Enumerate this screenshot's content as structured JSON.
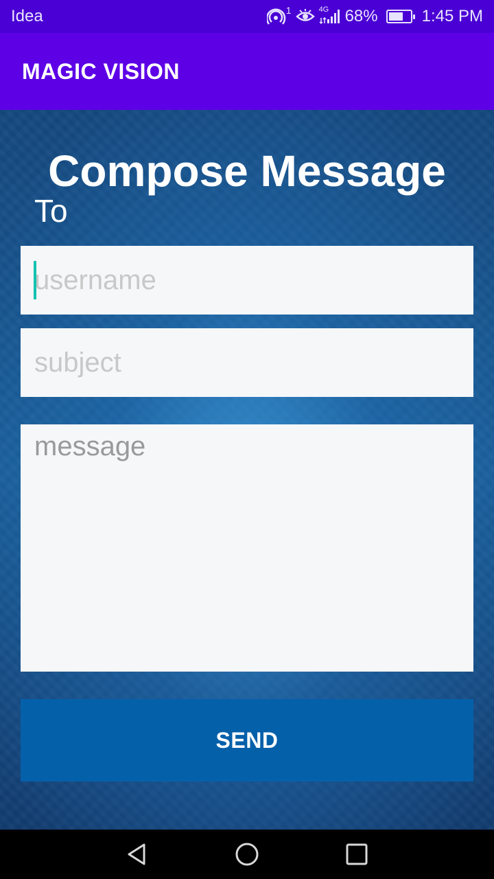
{
  "status_bar": {
    "carrier": "Idea",
    "hotspot_badge": "1",
    "network": "4G",
    "battery": "68%",
    "battery_level": 0.68,
    "time": "1:45 PM",
    "icons": [
      "hotspot-icon",
      "eye-icon",
      "signal-icon",
      "battery-icon"
    ]
  },
  "app_bar": {
    "title": "MAGIC VISION"
  },
  "compose": {
    "title": "Compose Message",
    "to_label": "To",
    "username_placeholder": "username",
    "subject_placeholder": "subject",
    "message_placeholder": "message",
    "send_label": "SEND"
  },
  "nav": {
    "icons": [
      "back-icon",
      "home-icon",
      "recents-icon"
    ]
  },
  "colors": {
    "status_bar": "#4a00d4",
    "app_bar": "#5d00e6",
    "send_button": "#0560aa",
    "cursor": "#12c2b0"
  }
}
